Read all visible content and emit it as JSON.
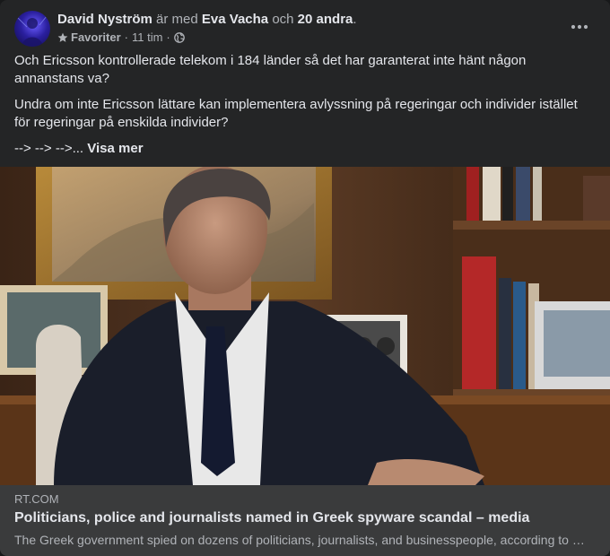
{
  "post": {
    "author": "David Nyström",
    "with_text": "är med",
    "tagged_person": "Eva Vacha",
    "and_text": "och",
    "others": "20 andra",
    "period": ".",
    "audience": "Favoriter",
    "time": "11 tim",
    "dot": "·",
    "paragraph_1": "Och Ericsson kontrollerade telekom i 184 länder så det har garanterat inte hänt någon annanstans va?",
    "paragraph_2": "Undra om inte Ericsson lättare kan implementera avlyssning på regeringar och individer istället för regeringar på enskilda individer?",
    "paragraph_3_prefix": "--> --> -->... ",
    "see_more": "Visa mer"
  },
  "link": {
    "domain": "RT.COM",
    "title": "Politicians, police and journalists named in Greek spyware scandal – media",
    "description": "The Greek government spied on dozens of politicians, journalists, and businesspeople, according to a newspaper report."
  },
  "icons": {
    "audience": "star-icon",
    "privacy": "globe-icon",
    "menu": "more-horizontal-icon"
  },
  "colors": {
    "card": "#242526",
    "link_footer": "#3a3b3c",
    "primary_text": "#e4e6eb",
    "secondary_text": "#b0b3b8"
  }
}
